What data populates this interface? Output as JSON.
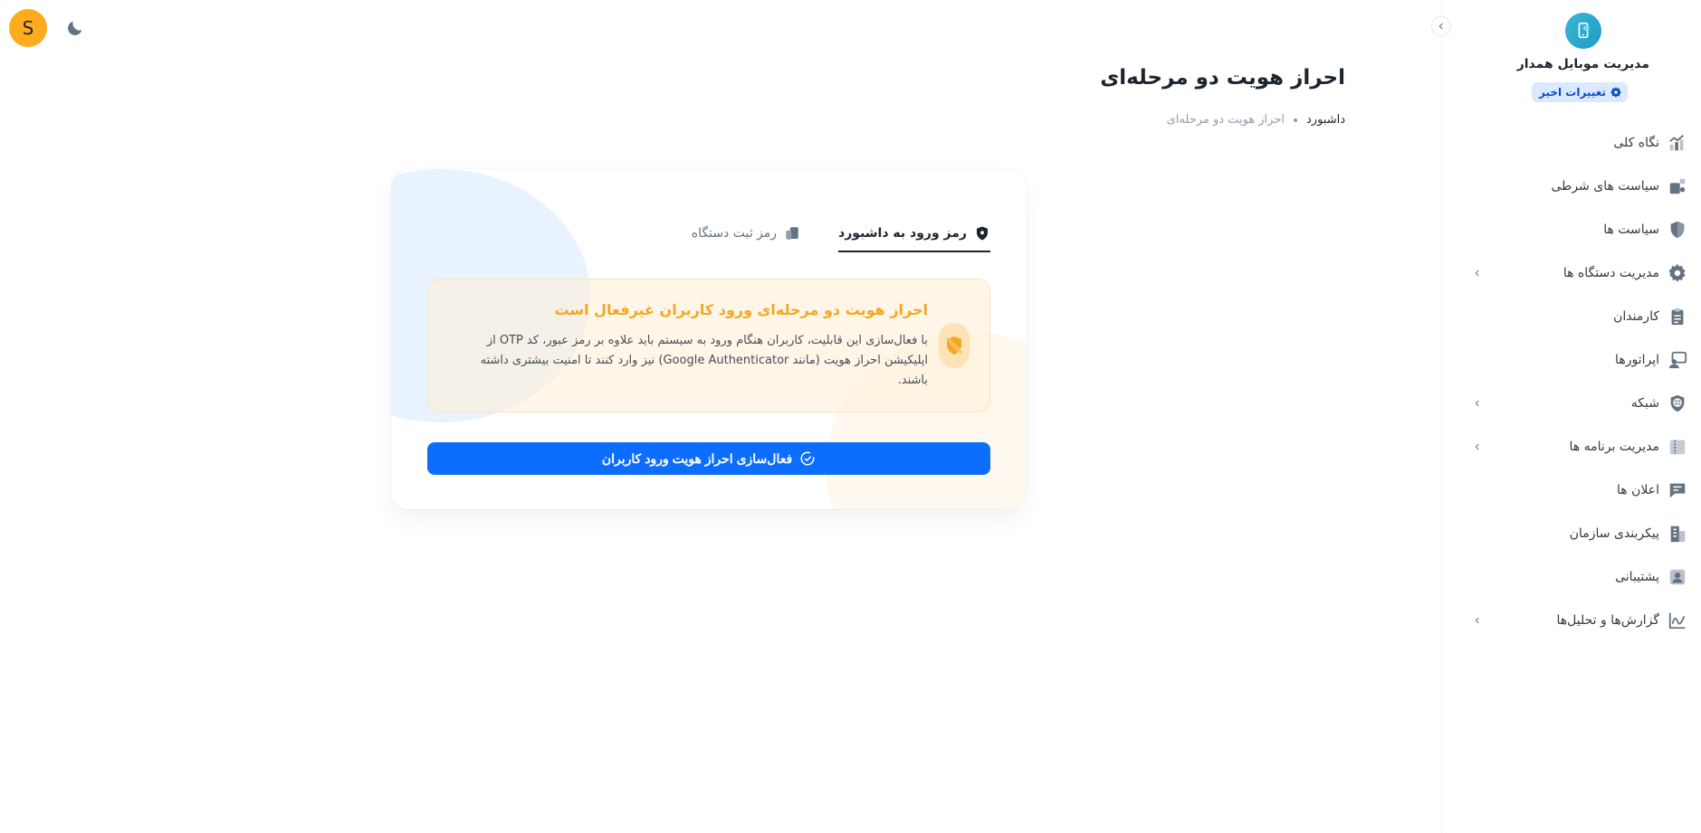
{
  "app": {
    "title": "مدیریت موبایل همدار",
    "recent_changes": "تغییرات اخیر",
    "accent": "#0d6efd",
    "logo_icon": "mobile-device-icon"
  },
  "sidebar": {
    "items": [
      {
        "label": "نگاه کلی",
        "icon": "analytics-icon",
        "expandable": false
      },
      {
        "label": "سیاست های شرطی",
        "icon": "conditional-policy-icon",
        "expandable": false
      },
      {
        "label": "سیاست ها",
        "icon": "shield-icon",
        "expandable": false
      },
      {
        "label": "مدیریت دستگاه ها",
        "icon": "gear-icon",
        "expandable": true
      },
      {
        "label": "کارمندان",
        "icon": "clipboard-icon",
        "expandable": false
      },
      {
        "label": "اپراتورها",
        "icon": "operator-icon",
        "expandable": false
      },
      {
        "label": "شبکه",
        "icon": "network-icon",
        "expandable": true
      },
      {
        "label": "مدیریت برنامه ها",
        "icon": "apps-icon",
        "expandable": true
      },
      {
        "label": "اعلان ها",
        "icon": "notification-icon",
        "expandable": false
      },
      {
        "label": "پیکربندی سازمان",
        "icon": "building-icon",
        "expandable": false
      },
      {
        "label": "پشتیبانی",
        "icon": "support-icon",
        "expandable": false
      },
      {
        "label": "گزارش‌ها و تحلیل‌ها",
        "icon": "report-chart-icon",
        "expandable": true
      }
    ]
  },
  "header": {
    "avatar_initial": "S",
    "avatar_color": "#ffab1f",
    "theme_icon": "moon-icon"
  },
  "page": {
    "title": "احراز هویت دو مرحله‌ای",
    "breadcrumb": {
      "home": "داشبورد",
      "current": "احراز هویت دو مرحله‌ای"
    }
  },
  "card": {
    "tabs": [
      {
        "label": "رمز ورود به داشبورد",
        "icon": "shield-lock-icon",
        "active": true
      },
      {
        "label": "رمز ثبت دستگاه",
        "icon": "devices-icon",
        "active": false
      }
    ],
    "alert": {
      "title": "احراز هویت دو مرحله‌ای ورود کاربران غیرفعال است",
      "body": "با فعال‌سازی این قابلیت، کاربران هنگام ورود به سیستم باید علاوه بر رمز عبور، کد OTP از اپلیکیشن احراز هویت (مانند Google Authenticator) نیز وارد کنند تا امنیت بیشتری داشته باشند.",
      "icon": "shield-off-icon",
      "color": "#f5a623"
    },
    "primary_button": "فعال‌سازی احراز هویت ورود کاربران"
  }
}
